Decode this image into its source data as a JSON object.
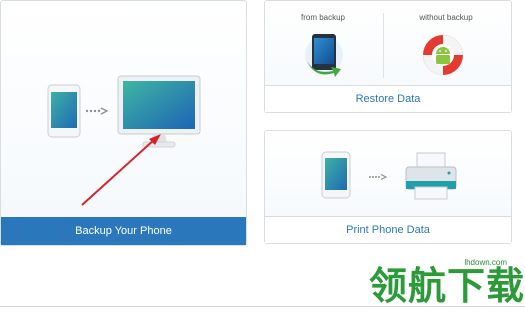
{
  "backup_card": {
    "label": "Backup Your Phone"
  },
  "restore_card": {
    "from_backup_label": "from backup",
    "without_backup_label": "without backup",
    "label": "Restore Data"
  },
  "print_card": {
    "label": "Print Phone Data"
  },
  "watermark": {
    "url": "lhdown.com",
    "text": "领航下载"
  },
  "colors": {
    "accent": "#2a78bb",
    "link_text": "#2b79b6",
    "arrow_annotation": "#d9232a",
    "watermark": "#2d9a3a"
  },
  "icons": [
    "phone-icon",
    "dots-arrow-icon",
    "monitor-icon",
    "backup-phone-icon",
    "lifebuoy-android-icon",
    "printer-icon"
  ]
}
